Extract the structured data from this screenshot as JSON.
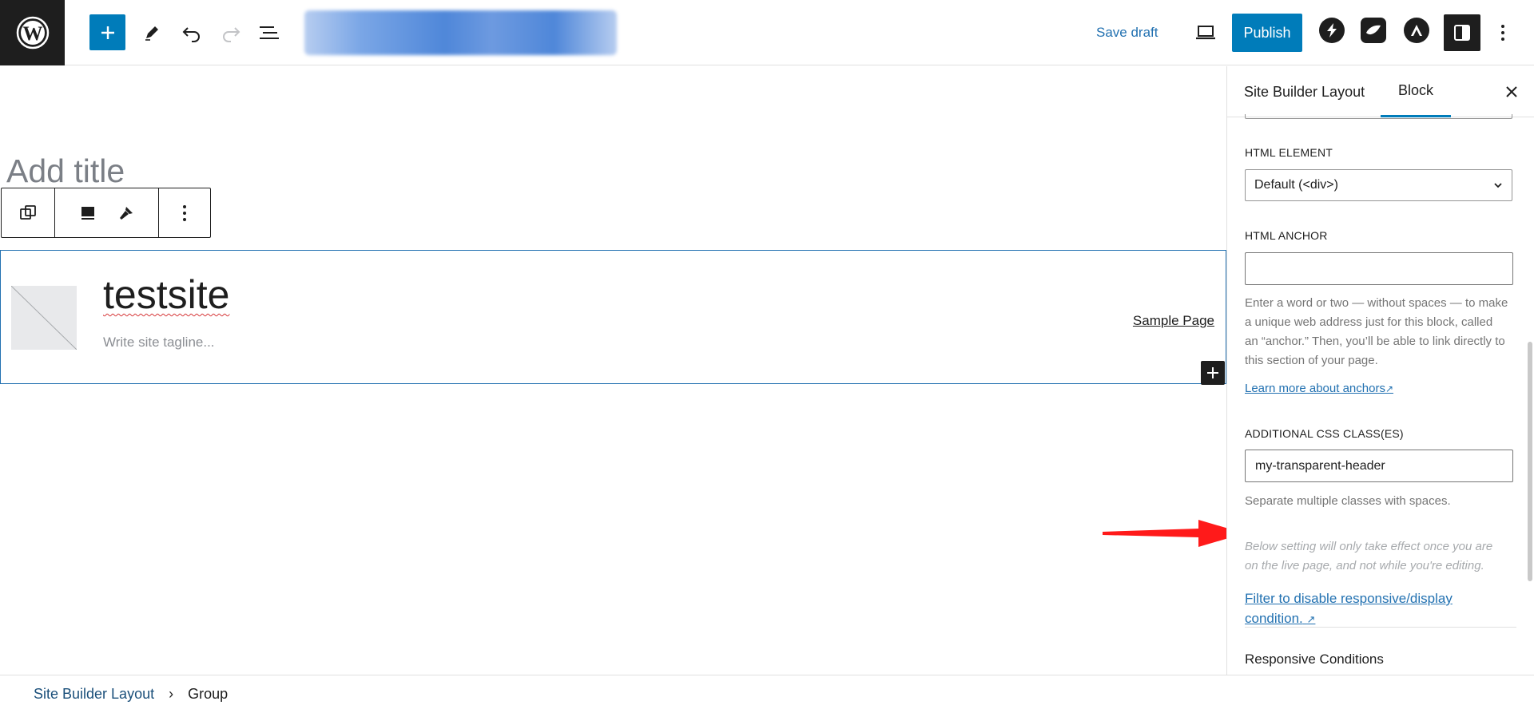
{
  "topbar": {
    "save_draft_label": "Save draft",
    "publish_label": "Publish",
    "accent_color": "#007cba"
  },
  "canvas": {
    "title_placeholder": "Add title",
    "site_title": "testsite",
    "site_tagline_placeholder": "Write site tagline...",
    "nav_link": "Sample Page"
  },
  "sidebar": {
    "tabs": [
      {
        "label": "Site Builder Layout",
        "active": false
      },
      {
        "label": "Block",
        "active": true
      }
    ],
    "html_element_label": "HTML ELEMENT",
    "html_element_value": "Default (<div>)",
    "html_anchor_label": "HTML ANCHOR",
    "html_anchor_value": "",
    "html_anchor_help": "Enter a word or two — without spaces — to make a unique web address just for this block, called an “anchor.” Then, you’ll be able to link directly to this section of your page.",
    "anchor_link": "Learn more about anchors",
    "css_classes_label": "ADDITIONAL CSS CLASS(ES)",
    "css_classes_value": "my-transparent-header",
    "css_classes_help": "Separate multiple classes with spaces.",
    "note": "Below setting will only take effect once you are on the live page, and not while you're editing.",
    "filter_link": "Filter to disable responsive/display condition.",
    "responsive_conditions": "Responsive Conditions"
  },
  "breadcrumbs": [
    "Site Builder Layout",
    "Group"
  ],
  "icons": {
    "logo": "wordpress-logo-icon",
    "add": "plus-icon",
    "tools": "pencil-icon",
    "undo": "undo-icon",
    "redo": "redo-icon",
    "outline": "list-view-icon",
    "preview": "laptop-icon",
    "settings": "sidebar-toggle-icon",
    "more": "vertical-ellipsis-icon",
    "close": "close-icon"
  }
}
